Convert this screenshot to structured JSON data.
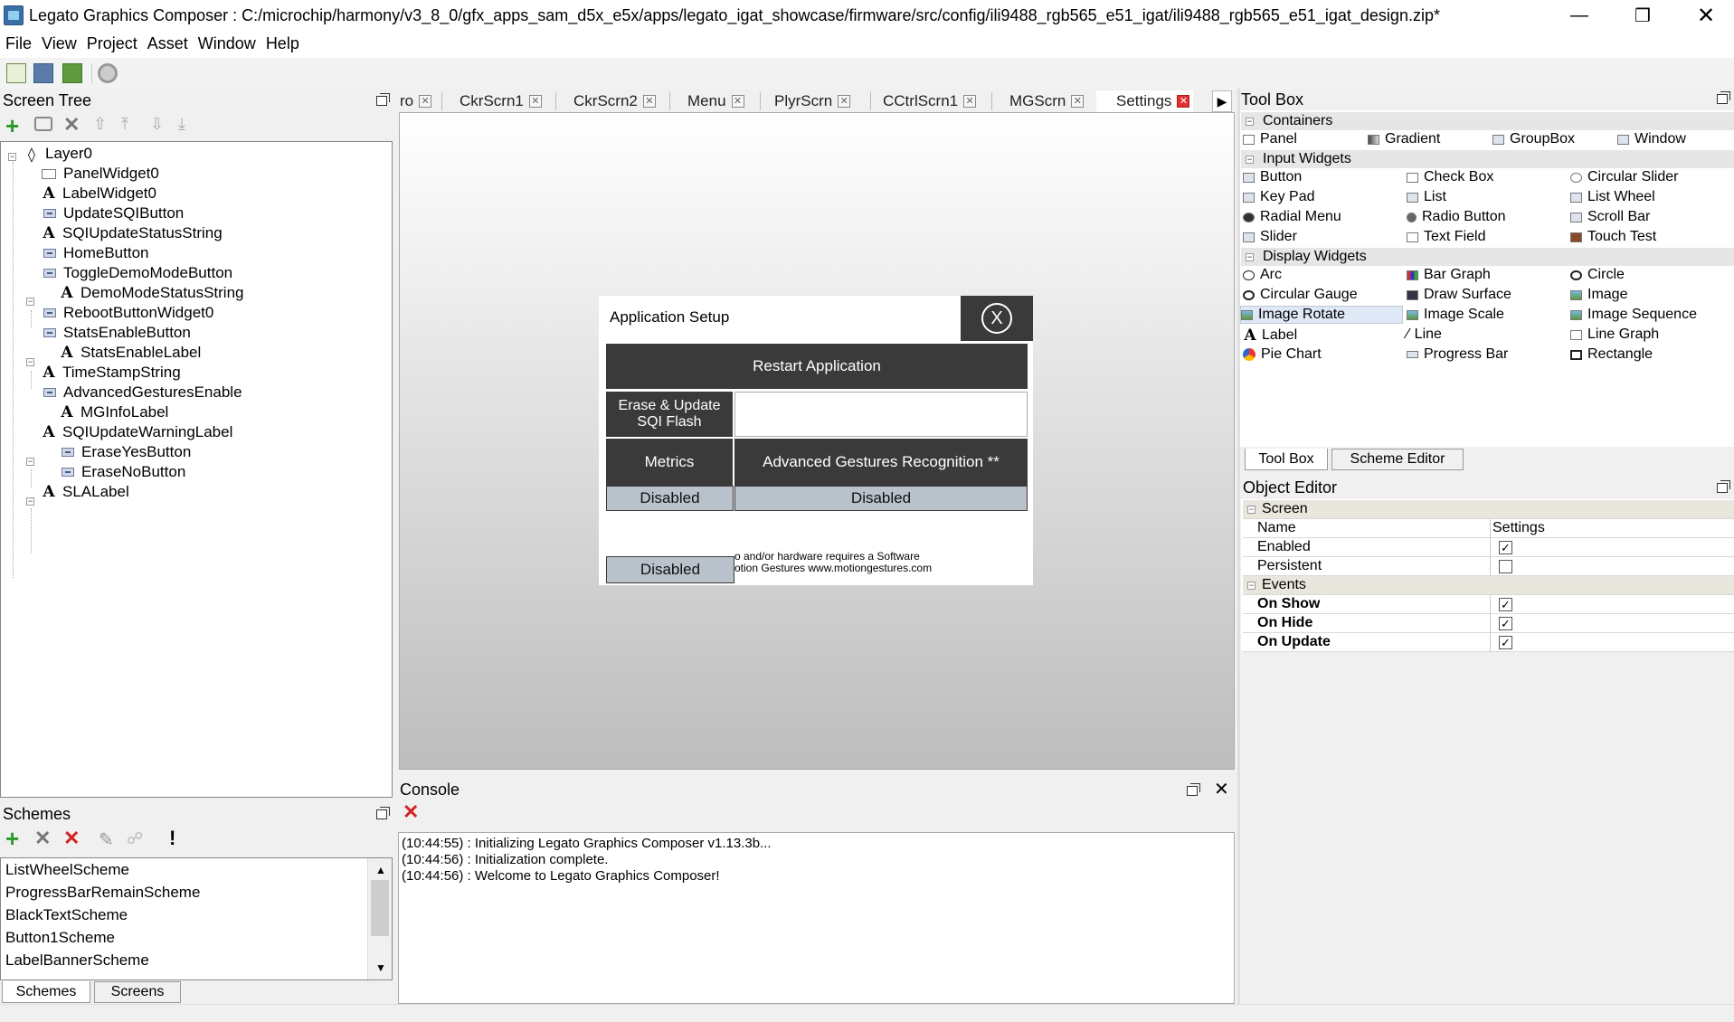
{
  "window": {
    "title": "Legato Graphics Composer : C:/microchip/harmony/v3_8_0/gfx_apps_sam_d5x_e5x/apps/legato_igat_showcase/firmware/src/config/ili9488_rgb565_e51_igat/ili9488_rgb565_e51_igat_design.zip*"
  },
  "menu": [
    "File",
    "View",
    "Project",
    "Asset",
    "Window",
    "Help"
  ],
  "screen_tree": {
    "title": "Screen Tree",
    "items": [
      "Layer0",
      "PanelWidget0",
      "LabelWidget0",
      "UpdateSQIButton",
      "SQIUpdateStatusString",
      "HomeButton",
      "ToggleDemoModeButton",
      "DemoModeStatusString",
      "RebootButtonWidget0",
      "StatsEnableButton",
      "StatsEnableLabel",
      "TimeStampString",
      "AdvancedGesturesEnable",
      "MGInfoLabel",
      "SQIUpdateWarningLabel",
      "EraseYesButton",
      "EraseNoButton",
      "SLALabel"
    ]
  },
  "tabs": [
    "ro",
    "CkrScrn1",
    "CkrScrn2",
    "Menu",
    "PlyrScrn",
    "CCtrlScrn1",
    "MGScrn",
    "Settings"
  ],
  "dialog": {
    "title": "Application Setup",
    "close": "X",
    "restart": "Restart Application",
    "erase": "Erase & Update SQI Flash",
    "metrics": "Metrics",
    "agr": "Advanced Gestures Recognition **",
    "disabled1": "Disabled",
    "disabled2": "Disabled",
    "disabled3": "Disabled",
    "note1": "o and/or hardware requires a Software",
    "note2": "otion Gestures www.motiongestures.com"
  },
  "toolbox": {
    "title": "Tool Box",
    "sections": {
      "containers": "Containers",
      "input": "Input Widgets",
      "display": "Display Widgets"
    },
    "containers": [
      "Panel",
      "Gradient",
      "GroupBox",
      "Window"
    ],
    "input": [
      "Button",
      "Check Box",
      "Circular Slider",
      "Key Pad",
      "List",
      "List Wheel",
      "Radial Menu",
      "Radio Button",
      "Scroll Bar",
      "Slider",
      "Text Field",
      "Touch Test"
    ],
    "display": [
      "Arc",
      "Bar Graph",
      "Circle",
      "Circular Gauge",
      "Draw Surface",
      "Image",
      "Image Rotate",
      "Image Scale",
      "Image Sequence",
      "Label",
      "Line",
      "Line Graph",
      "Pie Chart",
      "Progress Bar",
      "Rectangle"
    ],
    "tabs": [
      "Tool Box",
      "Scheme Editor"
    ]
  },
  "object_editor": {
    "title": "Object Editor",
    "screen": "Screen",
    "name_label": "Name",
    "name_value": "Settings",
    "enabled": "Enabled",
    "persistent": "Persistent",
    "events": "Events",
    "on_show": "On Show",
    "on_hide": "On Hide",
    "on_update": "On Update"
  },
  "schemes": {
    "title": "Schemes",
    "items": [
      "ListWheelScheme",
      "ProgressBarRemainScheme",
      "BlackTextScheme",
      "Button1Scheme",
      "LabelBannerScheme"
    ],
    "tabs": [
      "Schemes",
      "Screens"
    ]
  },
  "console": {
    "title": "Console",
    "lines": [
      "(10:44:55) : Initializing Legato Graphics Composer v1.13.3b...",
      "(10:44:56) : Initialization complete.",
      "(10:44:56) : Welcome to Legato Graphics Composer!"
    ]
  }
}
